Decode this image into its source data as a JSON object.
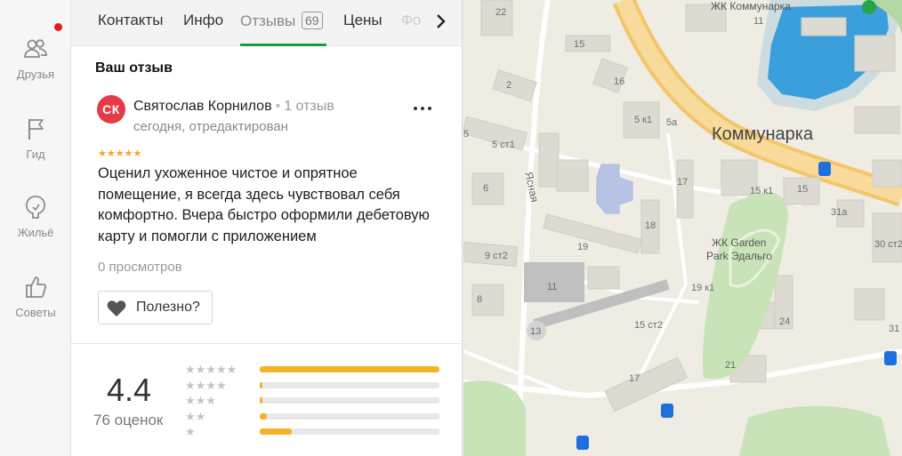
{
  "nav": {
    "items": [
      {
        "label": "Друзья",
        "icon": "friends-icon"
      },
      {
        "label": "Гид",
        "icon": "flag-icon"
      },
      {
        "label": "Жильё",
        "icon": "housing-icon"
      },
      {
        "label": "Советы",
        "icon": "thumbs-up-icon"
      }
    ]
  },
  "tabs": {
    "items": [
      {
        "label": "Контакты"
      },
      {
        "label": "Инфо"
      },
      {
        "label": "Отзывы",
        "count": "69"
      },
      {
        "label": "Цены"
      },
      {
        "label": "Фо"
      }
    ],
    "active": "Отзывы",
    "accent": "#1a9a3a"
  },
  "review": {
    "section_title": "Ваш отзыв",
    "avatar_initials": "СК",
    "avatar_color": "#e63a46",
    "author": "Святослав Корнилов",
    "author_reviews": "1 отзыв",
    "date": "сегодня, отредактирован",
    "stars": 5,
    "text": "Оценил ухоженное чистое и опрятное помещение, я всегда здесь чувствовал себя комфортно. Вчера быстро оформили дебетовую карту и помогли с приложением",
    "views": "0 просмотров",
    "useful_label": "Полезно?"
  },
  "rating": {
    "value": "4.4",
    "count_label": "76 оценок",
    "distribution": [
      {
        "stars": 5,
        "fraction": 1.0
      },
      {
        "stars": 4,
        "fraction": 0.01
      },
      {
        "stars": 3,
        "fraction": 0.01
      },
      {
        "stars": 2,
        "fraction": 0.04
      },
      {
        "stars": 1,
        "fraction": 0.18
      }
    ],
    "bar_color": "#f5b324"
  },
  "map": {
    "labels": {
      "city": "Коммунарка",
      "complex_top": "ЖК Коммунарка",
      "complex_garden_1": "ЖК Garden",
      "complex_garden_2": "Park Эдальго",
      "street": "Ясная",
      "h22": "22",
      "h15a": "15",
      "h2": "2",
      "h16": "16",
      "h5k1": "5 к1",
      "h5a": "5а",
      "h5": "5",
      "h5st1": "5 ст1",
      "h6": "6",
      "h17a": "17",
      "h18": "18",
      "h15k1": "15 к1",
      "h15b": "15",
      "h31a": "31а",
      "h30st2": "30 ст2",
      "h11top": "11",
      "h19": "19",
      "h9st2": "9 ст2",
      "h11": "11",
      "h8": "8",
      "h13": "13",
      "h15st2": "15 ст2",
      "h19k1": "19 к1",
      "h24": "24",
      "h21": "21",
      "h17b": "17",
      "h31": "31"
    }
  }
}
